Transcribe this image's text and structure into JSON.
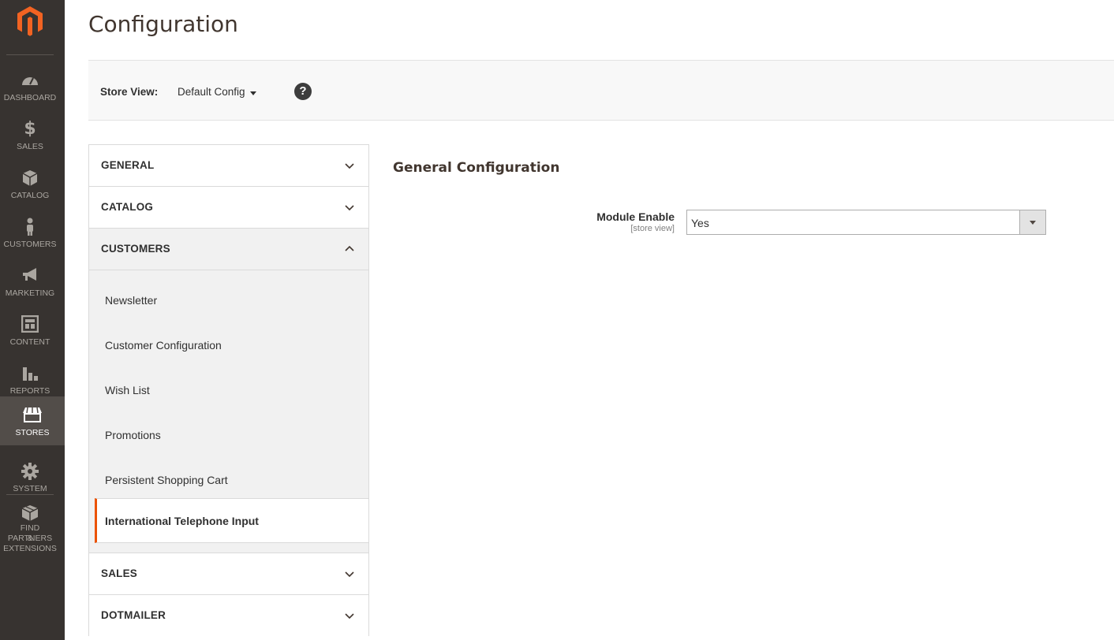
{
  "admin_menu": {
    "items": [
      {
        "label": "DASHBOARD",
        "icon": "dashboard-icon"
      },
      {
        "label": "SALES",
        "icon": "dollar-icon"
      },
      {
        "label": "CATALOG",
        "icon": "box-icon"
      },
      {
        "label": "CUSTOMERS",
        "icon": "person-icon"
      },
      {
        "label": "MARKETING",
        "icon": "megaphone-icon"
      },
      {
        "label": "CONTENT",
        "icon": "layout-icon"
      },
      {
        "label": "REPORTS",
        "icon": "bar-chart-icon"
      },
      {
        "label": "STORES",
        "icon": "store-icon",
        "active": true
      },
      {
        "label": "SYSTEM",
        "icon": "gear-icon"
      },
      {
        "label": "FIND PARTNERS",
        "label2": "& EXTENSIONS",
        "icon": "blocks-icon"
      }
    ]
  },
  "page": {
    "title": "Configuration"
  },
  "store_bar": {
    "label": "Store View:",
    "value": "Default Config",
    "help": "?"
  },
  "tabs": {
    "general": "GENERAL",
    "catalog": "CATALOG",
    "customers": "CUSTOMERS",
    "customers_items": [
      "Newsletter",
      "Customer Configuration",
      "Wish List",
      "Promotions",
      "Persistent Shopping Cart",
      "International Telephone Input"
    ],
    "sales": "SALES",
    "dotmailer": "DOTMAILER"
  },
  "main": {
    "section_title": "General Configuration",
    "field_label": "Module Enable",
    "field_scope": "[store view]",
    "field_value": "Yes"
  },
  "colors": {
    "accent": "#eb5202",
    "menu_bg": "#373330",
    "menu_active": "#524d49"
  }
}
